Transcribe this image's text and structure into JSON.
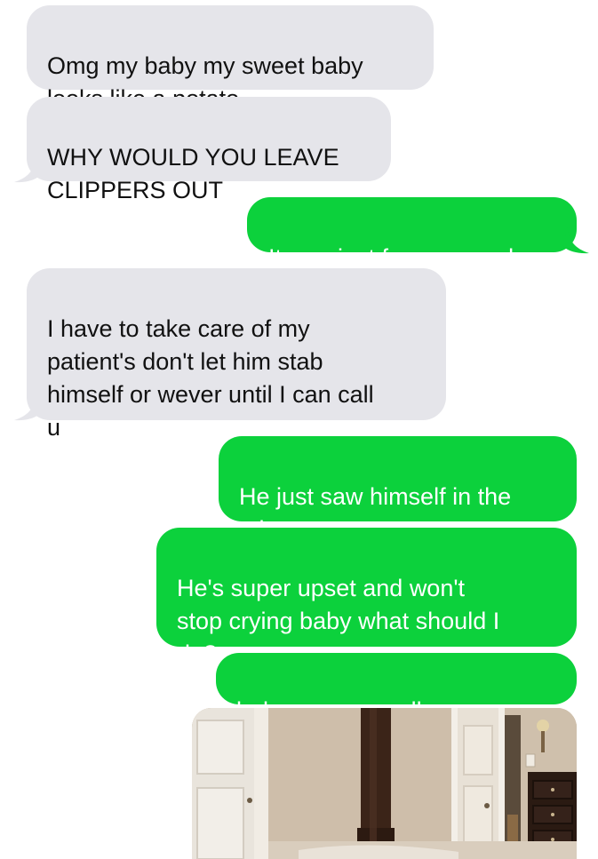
{
  "conversation": {
    "messages": [
      {
        "direction": "received",
        "text": "Omg my baby my sweet baby\nlooks like a potato"
      },
      {
        "direction": "received",
        "text": "WHY WOULD YOU LEAVE\nCLIPPERS OUT"
      },
      {
        "direction": "sent",
        "text": "It was just for a second"
      },
      {
        "direction": "received",
        "text": "I have to take care of my\npatient's don't let him stab\nhimself or wever until I can call\nu"
      },
      {
        "direction": "sent",
        "text": "He just saw himself in the\nmirror"
      },
      {
        "direction": "sent",
        "text": "He's super upset and won't\nstop crying baby what should I\ndo?"
      },
      {
        "direction": "sent",
        "text": "baby you can call me now"
      }
    ],
    "attachment": {
      "type": "photo",
      "subject": "room-with-doors"
    }
  },
  "colors": {
    "received_bubble": "#e5e5ea",
    "sent_bubble": "#0cd13c",
    "sent_text": "#ffffff",
    "received_text": "#111111"
  }
}
